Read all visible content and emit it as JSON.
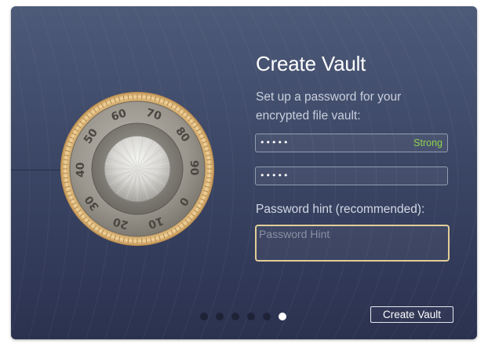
{
  "dialog": {
    "title": "Create Vault",
    "subtitle": "Set up a password for your encrypted file vault:"
  },
  "password": {
    "value_masked": "•••••",
    "strength_label": "Strong",
    "strength_color": "#8fd14f"
  },
  "confirm_password": {
    "value_masked": "•••••"
  },
  "hint": {
    "label": "Password hint (recommended):",
    "placeholder": "Password Hint",
    "value": ""
  },
  "dial": {
    "icon": "combination-lock-icon",
    "numbers": [
      "0",
      "10",
      "20",
      "30",
      "40",
      "50",
      "60",
      "70",
      "80",
      "90"
    ]
  },
  "pager": {
    "total": 6,
    "current": 6
  },
  "actions": {
    "create_label": "Create Vault"
  },
  "colors": {
    "background_top": "#4d5a78",
    "background_bottom": "#2b3250",
    "hint_border": "#e3cd97",
    "dial_rim": "#dcb06a"
  }
}
